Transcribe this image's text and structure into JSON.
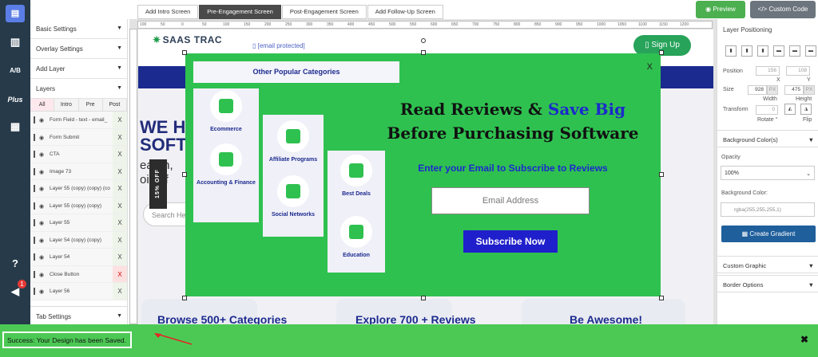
{
  "top_tabs": [
    "Add Intro Screen",
    "Pre-Engagement Screen",
    "Post-Engagement Screen",
    "Add Follow-Up Screen"
  ],
  "active_tab": 1,
  "preview_label": "Preview",
  "custom_code_label": "Custom Code",
  "left_panel": {
    "sections_top": [
      "Basic Settings",
      "Overlay Settings",
      "Add Layer",
      "Layers"
    ],
    "layer_filter_tabs": [
      "All",
      "Intro",
      "Pre",
      "Post"
    ],
    "layers": [
      "Form Field - text - email_",
      "Form Submit",
      "CTA",
      "Image 73",
      "Layer 55 (copy) (copy) (co",
      "Layer 55 (copy) (copy)",
      "Layer 55",
      "Layer 54 (copy) (copy)",
      "Layer 54",
      "Close Button",
      "Layer 56"
    ],
    "layer_close": "X",
    "tab_settings": "Tab Settings"
  },
  "ruler_ticks": [
    "100",
    "50",
    "0",
    "50",
    "100",
    "150",
    "200",
    "250",
    "300",
    "350",
    "400",
    "450",
    "500",
    "550",
    "600",
    "650",
    "700",
    "750",
    "800",
    "850",
    "900",
    "950",
    "1000",
    "1050",
    "1100",
    "1150",
    "1200"
  ],
  "site": {
    "brand": "SAAS TRAC",
    "email": "[email protected]",
    "signup": "Sign Up",
    "hero_big": "WE H\nSOFT",
    "hero_sub": "earch,\noice f",
    "search_placeholder": "Search Her",
    "offer_tab": "15% OFF",
    "card_texts": [
      "Browse 500+ Categories",
      "Explore 700 + Reviews",
      "Be Awesome!"
    ]
  },
  "popup": {
    "close": "X",
    "categories_title": "Other Popular Categories",
    "categories": [
      "Ecommerce",
      "Accounting & Finance",
      "Affiliate Programs",
      "Social Networks",
      "Best Deals",
      "Education"
    ],
    "headline_1": "Read Reviews &",
    "headline_highlight": "Save Big",
    "headline_2": "Before Purchasing Software",
    "subheadline": "Enter your Email to Subscribe to Reviews",
    "email_placeholder": "Email Address",
    "submit": "Subscribe Now"
  },
  "right_panel": {
    "title": "Layer Positioning",
    "position_label": "Position",
    "position_x": "156",
    "position_y": "108",
    "x_label": "X",
    "y_label": "Y",
    "size_label": "Size",
    "width": "928",
    "height": "475",
    "unit": "PX",
    "width_label": "Width",
    "height_label": "Height",
    "transform_label": "Transform",
    "rotate_value": "0",
    "rotate_label": "Rotate °",
    "flip_label": "Flip",
    "background_section": "Background Color(s)",
    "opacity_label": "Opacity",
    "opacity_value": "100%",
    "bg_color_label": "Background Color:",
    "bg_color_value": "rgba(255,255,255,1)",
    "gradient_button": "Create Gradient",
    "custom_graphic": "Custom Graphic",
    "border_options": "Border Options"
  },
  "notification_count": "1",
  "status_message": "Success: Your Design has been Saved.",
  "status_close": "✖",
  "colors": {
    "popup_bg": "#2fc150",
    "accent_blue": "#1b2acb",
    "status_green": "#4cc955"
  }
}
